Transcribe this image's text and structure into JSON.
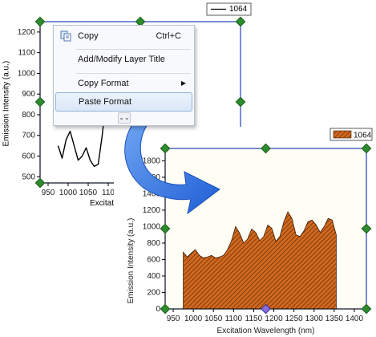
{
  "top_graph": {
    "legend_label": "1064",
    "ylabel": "Emission Intensity (a.u.)",
    "xlabel": "Excitation Wavelength (nm)",
    "xlabel_visible": "Excitatio",
    "yticks": [
      "1200",
      "1100",
      "1000",
      "900",
      "800",
      "700",
      "600",
      "500"
    ],
    "xticks": [
      "950",
      "1000",
      "1050",
      "110"
    ],
    "line_color": "#000000"
  },
  "context_menu": {
    "items": [
      {
        "label": "Copy",
        "shortcut": "Ctrl+C",
        "icon": "copy-icon"
      },
      {
        "label": "Add/Modify Layer Title"
      },
      {
        "label": "Copy Format",
        "has_submenu": true
      },
      {
        "label": "Paste Format",
        "highlighted": true
      }
    ],
    "expand_icon": "double-chevron-down-icon"
  },
  "arrow": {
    "color": "#2f6fe0",
    "icon": "curved-arrow-icon"
  },
  "bottom_graph": {
    "legend_label": "1064",
    "ylabel": "Emission Intensity (a.u.)",
    "xlabel": "Excitation Wavelength (nm)",
    "yticks": [
      "1800",
      "1600",
      "1400",
      "1200",
      "1000",
      "800",
      "600",
      "400",
      "200",
      "0"
    ],
    "xticks": [
      "950",
      "1000",
      "1050",
      "1100",
      "1150",
      "1200",
      "1250",
      "1300",
      "1350",
      "1400"
    ],
    "fill_color": "#d2691e",
    "hatch_color": "#5a2a08",
    "handle_color": "#2e8b2e",
    "frame_color": "#1f3fbf"
  },
  "chart_data": [
    {
      "type": "line",
      "series": [
        {
          "x": [
            975,
            985,
            995,
            1005,
            1015,
            1025,
            1035,
            1045,
            1055,
            1065,
            1075,
            1085,
            1095,
            1105,
            1115,
            1125,
            1135,
            1145,
            1155,
            1165,
            1175,
            1185,
            1195,
            1205,
            1215,
            1225,
            1235,
            1245,
            1255,
            1265,
            1275,
            1285
          ],
          "y": [
            650,
            590,
            680,
            720,
            650,
            580,
            600,
            640,
            580,
            550,
            560,
            700,
            880,
            980,
            940,
            860,
            920,
            1000,
            960,
            900,
            980,
            1040,
            980,
            900,
            960,
            1060,
            1080,
            1000,
            920,
            960,
            1040,
            870
          ]
        }
      ],
      "xticks": [
        950,
        1000,
        1050,
        1100
      ],
      "yticks": [
        500,
        600,
        700,
        800,
        900,
        1000,
        1100,
        1200
      ],
      "xlim": [
        930,
        1430
      ],
      "ylim": [
        470,
        1250
      ],
      "legend": "1064",
      "legend_position": "top-right",
      "xlabel": "Excitation Wavelength (nm)",
      "ylabel": "Emission Intensity (a.u.)"
    },
    {
      "type": "area",
      "series": [
        {
          "x": [
            975,
            985,
            995,
            1005,
            1015,
            1025,
            1035,
            1045,
            1055,
            1065,
            1075,
            1085,
            1095,
            1105,
            1115,
            1125,
            1135,
            1145,
            1155,
            1165,
            1175,
            1185,
            1195,
            1205,
            1215,
            1225,
            1235,
            1245,
            1255,
            1265,
            1275,
            1285,
            1295,
            1305,
            1315,
            1325,
            1335,
            1345,
            1355
          ],
          "y": [
            690,
            630,
            680,
            720,
            650,
            620,
            630,
            650,
            620,
            630,
            650,
            720,
            830,
            1000,
            920,
            800,
            850,
            970,
            930,
            830,
            880,
            1020,
            980,
            820,
            880,
            1060,
            1180,
            1100,
            900,
            880,
            950,
            1060,
            1080,
            1020,
            930,
            1000,
            1100,
            1080,
            900
          ]
        }
      ],
      "xticks": [
        950,
        1000,
        1050,
        1100,
        1150,
        1200,
        1250,
        1300,
        1350,
        1400
      ],
      "yticks": [
        0,
        200,
        400,
        600,
        800,
        1000,
        1200,
        1400,
        1600,
        1800
      ],
      "xlim": [
        930,
        1430
      ],
      "ylim": [
        0,
        1950
      ],
      "legend": "1064",
      "legend_position": "top-right",
      "xlabel": "Excitation Wavelength (nm)",
      "ylabel": "Emission Intensity (a.u.)"
    }
  ]
}
